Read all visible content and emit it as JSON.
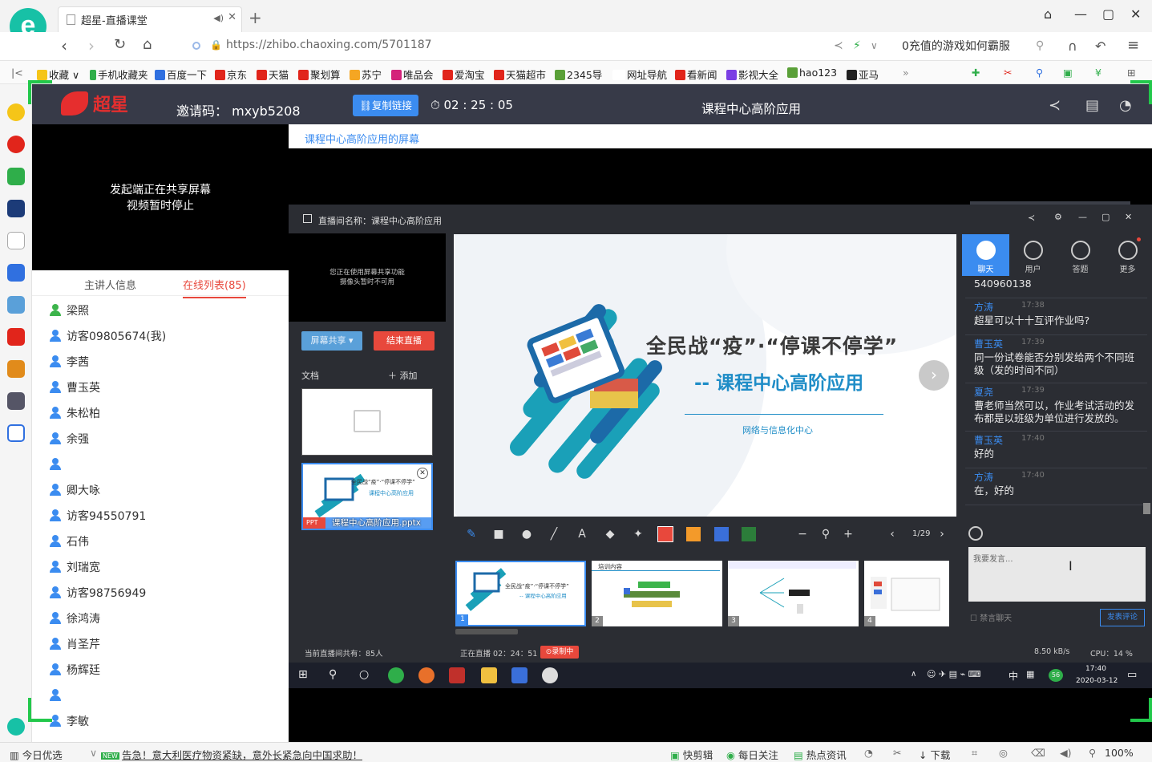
{
  "browser": {
    "tab_title": "超星-直播课堂",
    "url": "https://zhibo.chaoxing.com/5701187",
    "search_text": "0充值的游戏如何霸服",
    "bookmarks": [
      "收藏",
      "手机收藏夹",
      "百度一下",
      "京东",
      "天猫",
      "聚划算",
      "苏宁",
      "唯品会",
      "爱淘宝",
      "天猫超市",
      "2345导",
      "网址导航",
      "看新闻",
      "影视大全",
      "hao123",
      "亚马"
    ],
    "more": "»"
  },
  "header": {
    "logo_text": "超星",
    "invite_label": "邀请码：",
    "invite_code": "mxyb5208",
    "copy_link": "复制链接",
    "timer": "02 : 25 : 05",
    "course_title": "课程中心高阶应用"
  },
  "video": {
    "line1": "发起端正在共享屏幕",
    "line2": "视频暂时停止"
  },
  "info_tabs": {
    "presenter": "主讲人信息",
    "online": "在线列表(85)"
  },
  "users": [
    "梁照",
    "访客09805674(我)",
    "李茜",
    "曹玉英",
    "朱松柏",
    "余强",
    "",
    "卿大咏",
    "访客94550791",
    "石伟",
    "刘瑞宽",
    "访客98756949",
    "徐鸿涛",
    "肖圣芹",
    "杨辉廷",
    "",
    "李敏"
  ],
  "share": {
    "label": "课程中心高阶应用的屏幕"
  },
  "inner": {
    "title": "直播间名称：课程中心高阶应用",
    "cam_line1": "您正在使用屏幕共享功能",
    "cam_line2": "摄像头暂时不可用",
    "btn_share": "屏幕共享 ▾",
    "btn_end": "结束直播",
    "doc_label": "文档",
    "doc_add": "＋ 添加",
    "ppt_tag": "PPT",
    "ppt_name": "课程中心高阶应用.pptx",
    "slide": {
      "headline": "全民战“疫”·“停课不停学”",
      "subtitle": "-- 课程中心高阶应用",
      "org": "网络与信息化中心"
    },
    "page_count": "1/29",
    "thumbs": [
      "1",
      "2",
      "3",
      "4"
    ],
    "thumb_titles": [
      "",
      "培训内容",
      "",
      ""
    ],
    "chat_tabs": [
      "聊天",
      "用户",
      "答题",
      "更多"
    ],
    "messages": [
      {
        "name": "",
        "time": "",
        "text": "540960138"
      },
      {
        "name": "方涛",
        "time": "17:38",
        "text": "超星可以十十互评作业吗?"
      },
      {
        "name": "曹玉英",
        "time": "17:39",
        "text": "同一份试卷能否分别发给两个不同班级（发的时间不同）"
      },
      {
        "name": "夏尧",
        "time": "17:39",
        "text": "曹老师当然可以，作业考试活动的发布都是以班级为单位进行发放的。"
      },
      {
        "name": "曹玉英",
        "time": "17:40",
        "text": "好的"
      },
      {
        "name": "方涛",
        "time": "17:40",
        "text": "在，好的"
      }
    ],
    "chat_placeholder": "我要发言...",
    "mute_chat": "禁言聊天",
    "send": "发表评论",
    "status_online": "当前直播间共有：85人",
    "status_live": "正在直播 02：24：51",
    "status_rec": "录制中",
    "status_net": "8.50 kB/s",
    "status_cpu": "CPU：14 %",
    "tray_time": "17:40",
    "tray_date": "2020-03-12",
    "tray_lang": "中",
    "tray_badge": "56"
  },
  "bottombar": {
    "today": "今日优选",
    "news_tag": "NEW",
    "news": "告急！意大利医疗物资紧缺，意外长紧急向中国求助！",
    "quick_cut": "快剪辑",
    "daily": "每日关注",
    "hot": "热点资讯",
    "download": "下载",
    "zoom": "100%"
  }
}
